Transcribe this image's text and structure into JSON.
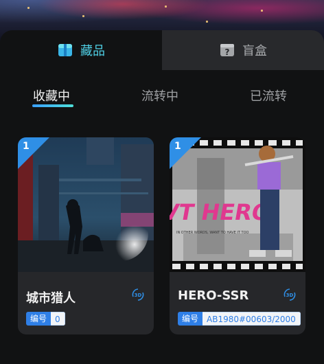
{
  "tabs": {
    "collection_label": "藏品",
    "blindbox_label": "盲盒"
  },
  "sub_tabs": {
    "collecting": "收藏中",
    "transferring": "流转中",
    "transferred": "已流转"
  },
  "cards": [
    {
      "badge": "1",
      "title": "城市猎人",
      "id_label": "编号",
      "id_value": "0"
    },
    {
      "badge": "1",
      "title": "HERO-SSR",
      "id_label": "编号",
      "id_value": "AB1980#00603/2000"
    }
  ],
  "colors": {
    "accent": "#4fd0e6",
    "badge": "#2f8fe6",
    "background": "#111213",
    "card": "#26272a"
  },
  "icons": [
    "collection-box-icon",
    "blindbox-question-icon",
    "view-3d-icon"
  ]
}
